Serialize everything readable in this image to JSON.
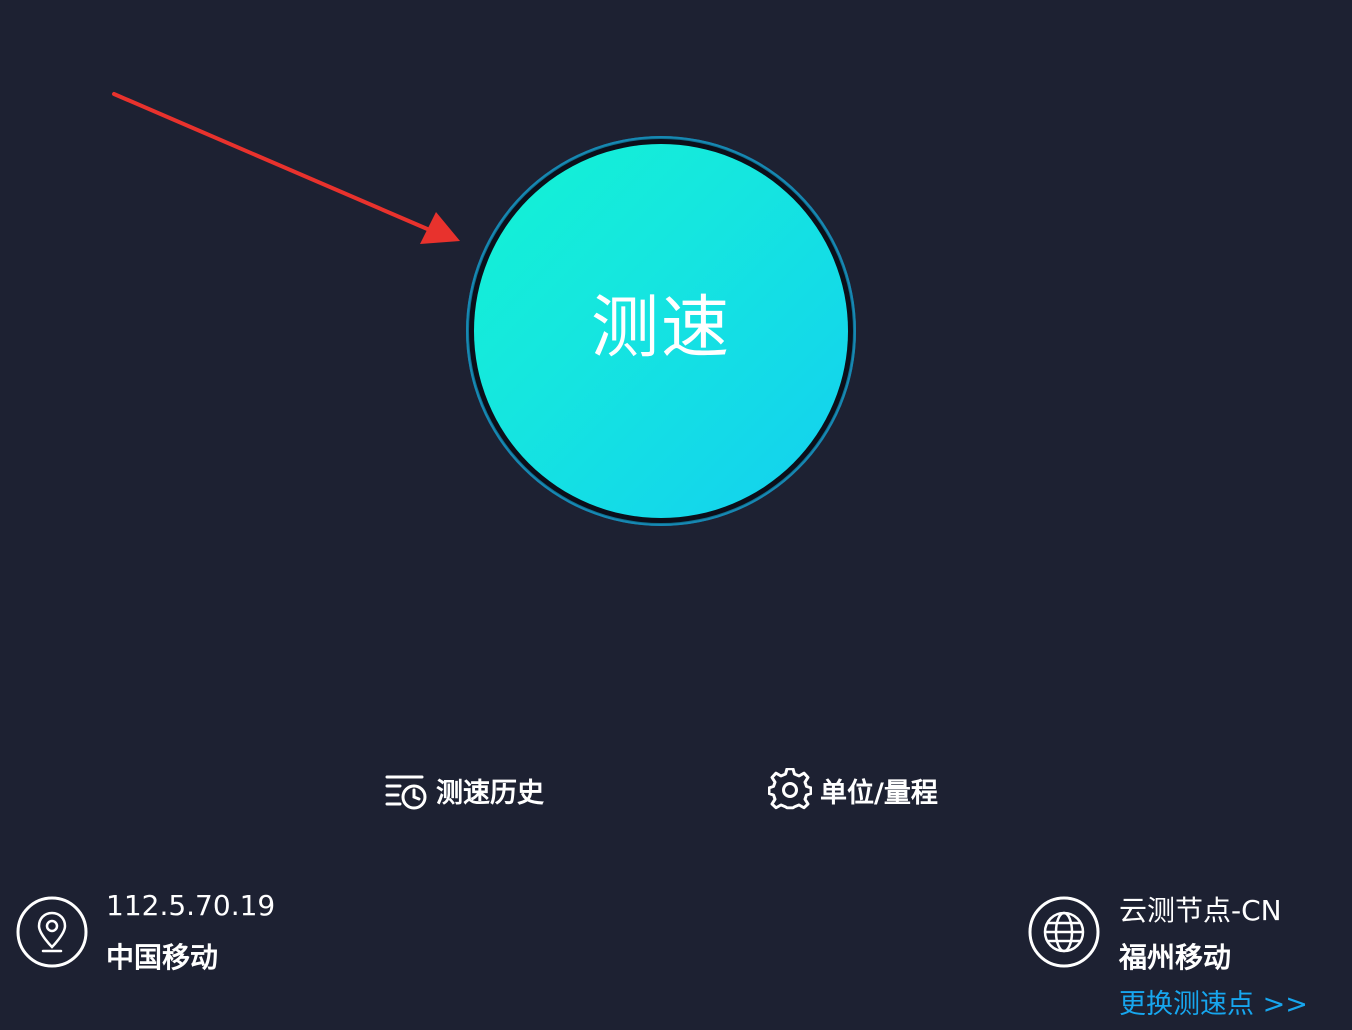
{
  "start": {
    "label": "测速"
  },
  "actions": {
    "history_label": "测速历史",
    "units_label": "单位/量程"
  },
  "client": {
    "ip": "112.5.70.19",
    "isp": "中国移动"
  },
  "server": {
    "node": "云测节点-CN",
    "isp": "福州移动",
    "change_label": "更换测速点 >>"
  },
  "icons": {
    "history": "history-clock-icon",
    "units": "gear-icon",
    "client": "location-pin-icon",
    "server": "globe-icon"
  },
  "colors": {
    "background": "#1d2132",
    "accent_start": "#14f3d4",
    "accent_end": "#13cff0",
    "link": "#17a6ee",
    "annotation": "#e8322d"
  }
}
